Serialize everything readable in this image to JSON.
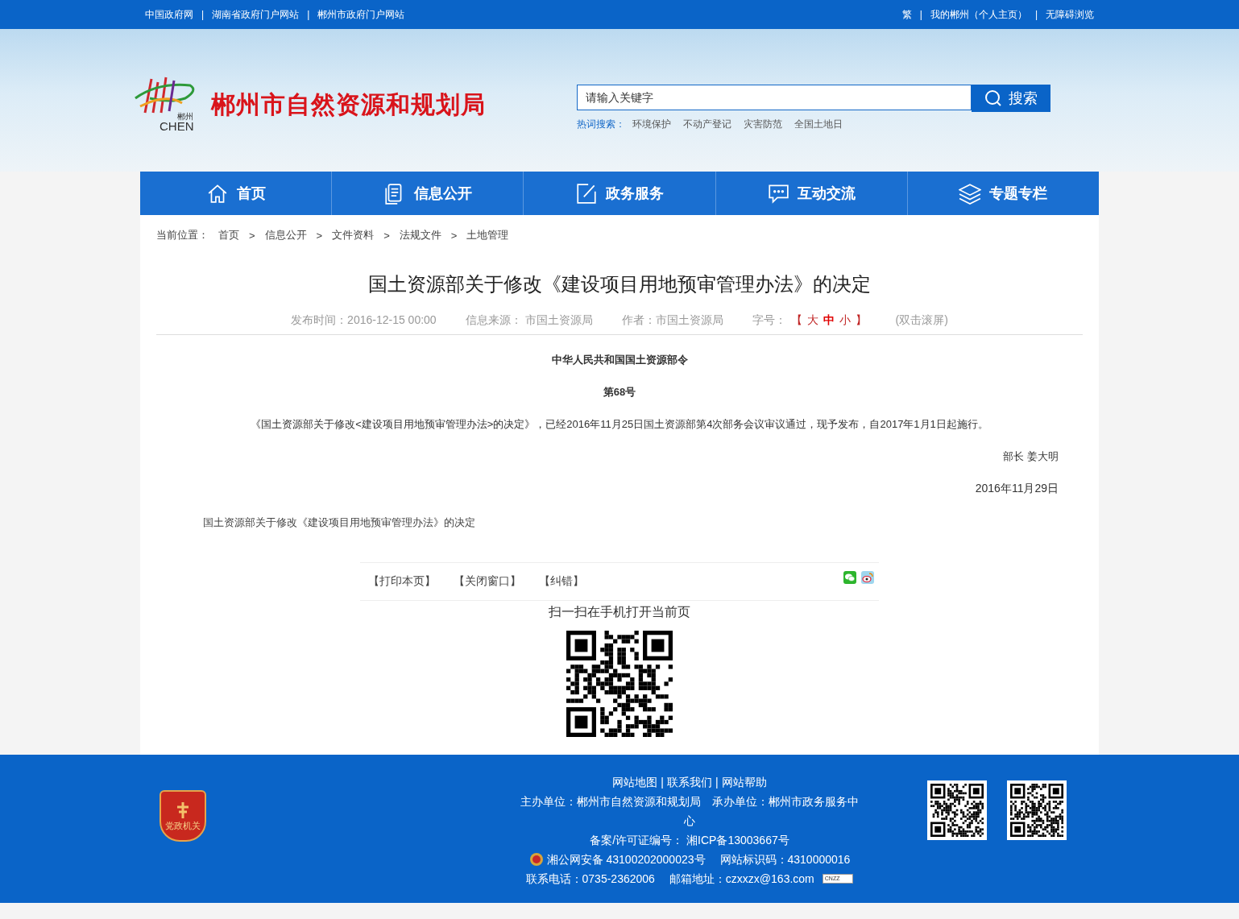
{
  "top_bar": {
    "left_links": [
      "中国政府网",
      "湖南省政府门户网站",
      "郴州市政府门户网站"
    ],
    "right_links": [
      "繁",
      "我的郴州（个人主页）",
      "无障碍浏览"
    ],
    "separator": "|"
  },
  "header": {
    "logo_city": "郴州",
    "logo_word": "CHEN",
    "site_title": "郴州市自然资源和规划局",
    "search": {
      "placeholder": "请输入关键字",
      "button": "搜索"
    },
    "hot_label": "热词搜索：",
    "hot_words": [
      "环境保护",
      "不动产登记",
      "灾害防范",
      "全国土地日"
    ]
  },
  "nav": [
    {
      "label": "首页",
      "kind": "home"
    },
    {
      "label": "信息公开",
      "kind": "document"
    },
    {
      "label": "政务服务",
      "kind": "edit"
    },
    {
      "label": "互动交流",
      "kind": "chat"
    },
    {
      "label": "专题专栏",
      "kind": "layers"
    }
  ],
  "breadcrumb": {
    "label": "当前位置：",
    "items": [
      "首页",
      "信息公开",
      "文件资料",
      "法规文件",
      "土地管理"
    ],
    "separator": ">"
  },
  "article": {
    "title": "国土资源部关于修改《建设项目用地预审管理办法》的决定",
    "meta": {
      "published": "发布时间：2016-12-15 00:00",
      "source": "信息来源： 市国土资源局",
      "author": "作者：市国土资源局",
      "font_label": "字号：",
      "bracket_open": "【",
      "bracket_close": "】",
      "font_sizes": [
        {
          "label": "大",
          "selected": false
        },
        {
          "label": "中",
          "selected": true
        },
        {
          "label": "小",
          "selected": false
        }
      ],
      "scroll_hint": "(双击滚屏)"
    },
    "body": [
      {
        "kind": "heading",
        "text": "中华人民共和国国土资源部令"
      },
      {
        "kind": "heading",
        "text": "第68号"
      },
      {
        "kind": "paragraph",
        "text": "《国土资源部关于修改<建设项目用地预审管理办法>的决定》，已经2016年11月25日国土资源部第4次部务会议审议通过，现予发布，自2017年1月1日起施行。"
      },
      {
        "kind": "signature",
        "text": "部长 姜大明"
      },
      {
        "kind": "date",
        "text": "2016年11月29日"
      }
    ],
    "attachment": "国土资源部关于修改《建设项目用地预审管理办法》的决定",
    "actions": [
      "【打印本页】",
      "【关闭窗口】",
      "【纠错】"
    ],
    "qr_caption": "扫一扫在手机打开当前页"
  },
  "footer": {
    "links": [
      "网站地图",
      "联系我们",
      "网站帮助"
    ],
    "separator": "|",
    "emblem_text": "党政机关",
    "sponsor": "主办单位：郴州市自然资源和规划局　承办单位：郴州市政务服务中心",
    "icp": "备案/许可证编号： 湘ICP备13003667号",
    "police": "湘公网安备 43100202000023号",
    "site_code": "网站标识码：4310000016",
    "phone": "联系电话：0735-2362006",
    "email": "邮箱地址：czxxzx@163.com",
    "stat_badge": "CNZZ"
  }
}
